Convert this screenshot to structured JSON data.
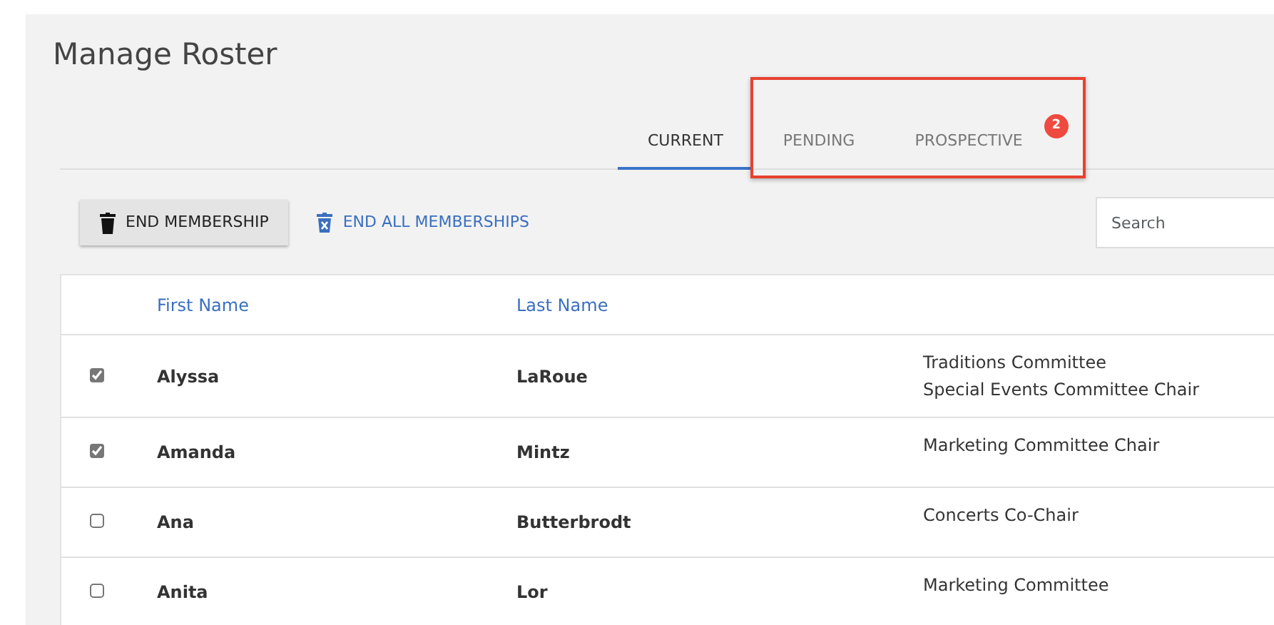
{
  "title": "Manage Roster",
  "tabs": [
    {
      "label": "CURRENT",
      "selected": true,
      "highlighted": false
    },
    {
      "label": "PENDING",
      "selected": false,
      "highlighted": true
    },
    {
      "label": "PROSPECTIVE",
      "selected": false,
      "highlighted": true,
      "badge": "2"
    }
  ],
  "highlight": {
    "color": "#e8412f"
  },
  "toolbar": {
    "end_membership": "END MEMBERSHIP",
    "end_all": "END ALL MEMBERSHIPS",
    "search": {
      "placeholder": "Search"
    }
  },
  "table": {
    "columns": [
      "First Name",
      "Last Name"
    ],
    "rows": [
      {
        "checked": true,
        "first_name": "Alyssa",
        "last_name": "LaRoue",
        "positions": [
          "Traditions Committee",
          "Special Events Committee Chair"
        ]
      },
      {
        "checked": true,
        "first_name": "Amanda",
        "last_name": "Mintz",
        "positions": [
          "Marketing Committee Chair"
        ]
      },
      {
        "checked": false,
        "first_name": "Ana",
        "last_name": "Butterbrodt",
        "positions": [
          "Concerts Co-Chair"
        ]
      },
      {
        "checked": false,
        "first_name": "Anita",
        "last_name": "Lor",
        "positions": [
          "Marketing Committee"
        ]
      }
    ]
  }
}
